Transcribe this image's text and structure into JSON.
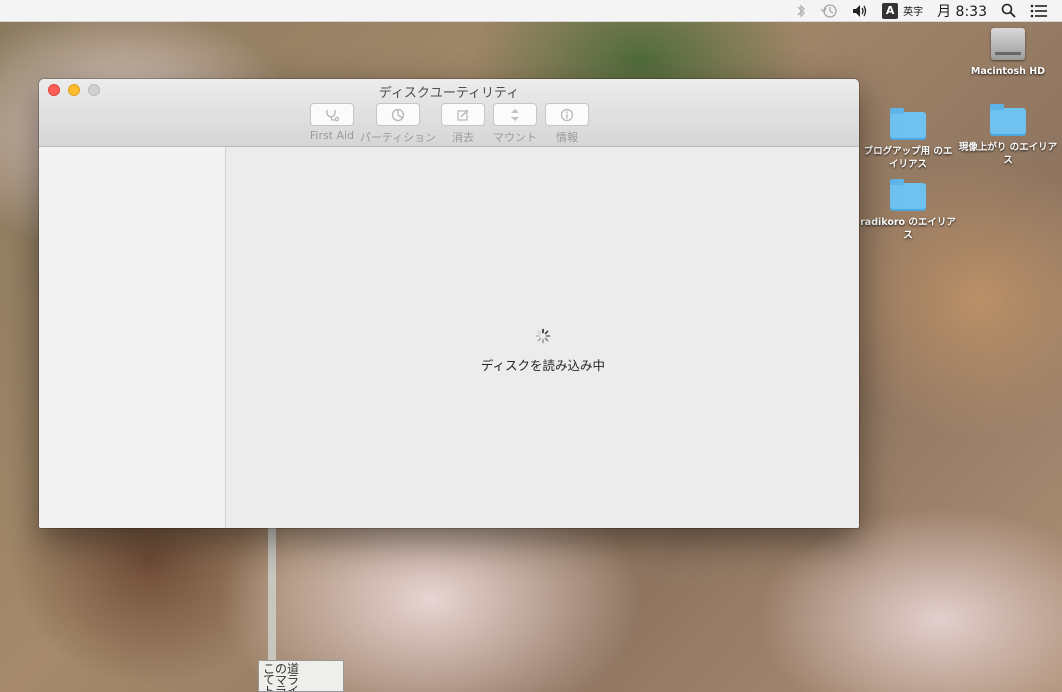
{
  "menubar": {
    "bluetooth_icon": "bluetooth-icon",
    "time_machine_icon": "time-machine-icon",
    "volume_icon": "volume-icon",
    "input_badge": "A",
    "input_label": "英字",
    "clock": "月 8:33",
    "spotlight_icon": "search-icon",
    "notification_icon": "list-icon"
  },
  "desktop": {
    "icons": [
      {
        "label": "Macintosh HD",
        "kind": "hdd"
      },
      {
        "label": "ブログアップ用 のエイリアス",
        "kind": "folder"
      },
      {
        "label": "現像上がり のエイリアス",
        "kind": "folder"
      },
      {
        "label": "radikoro のエイリアス",
        "kind": "folder"
      }
    ]
  },
  "sign": {
    "text": "この道\nてマラ\nトライ"
  },
  "window": {
    "title": "ディスクユーティリティ",
    "toolbar": [
      {
        "label": "First Aid",
        "icon": "stethoscope-icon"
      },
      {
        "label": "パーティション",
        "icon": "partition-icon"
      },
      {
        "label": "消去",
        "icon": "erase-icon"
      },
      {
        "label": "マウント",
        "icon": "mount-icon"
      },
      {
        "label": "情報",
        "icon": "info-icon"
      }
    ],
    "status_text": "ディスクを読み込み中"
  }
}
